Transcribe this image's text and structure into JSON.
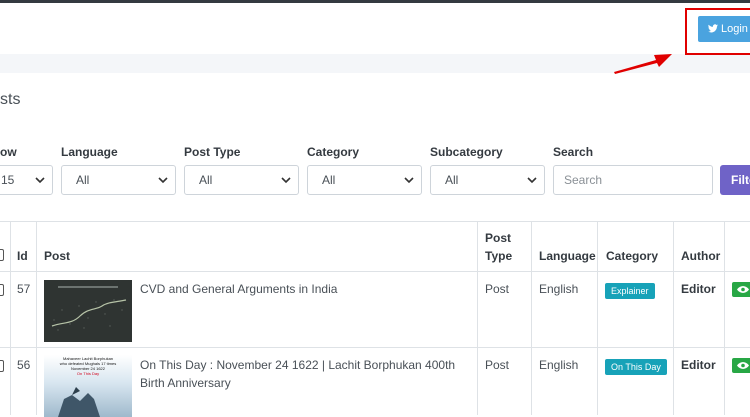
{
  "header": {
    "login_label": "Login w"
  },
  "card": {
    "title": "sts"
  },
  "filters": {
    "show": {
      "label": "ow",
      "value": "15"
    },
    "language": {
      "label": "Language",
      "value": "All"
    },
    "post_type": {
      "label": "Post Type",
      "value": "All"
    },
    "category": {
      "label": "Category",
      "value": "All"
    },
    "subcategory": {
      "label": "Subcategory",
      "value": "All"
    },
    "search": {
      "label": "Search",
      "placeholder": "Search"
    },
    "filter_button": "Filte"
  },
  "table": {
    "headers": {
      "id": "Id",
      "post": "Post",
      "post_type_1": "Post",
      "post_type_2": "Type",
      "language": "Language",
      "category": "Category",
      "author": "Author"
    },
    "rows": [
      {
        "id": "57",
        "post": "CVD and General Arguments in India",
        "post_type": "Post",
        "language": "English",
        "category": "Explainer",
        "author": "Editor"
      },
      {
        "id": "56",
        "post": "On This Day : November 24 1622 | Lachit Borphukan 400th Birth Anniversary",
        "post_type": "Post",
        "language": "English",
        "category": "On This Day",
        "author": "Editor"
      }
    ],
    "thumb2_text": {
      "line1": "Mahaveer Lachit Borphukan",
      "line2": "who defeated Mughals 17 times",
      "line3": "November 24 1622",
      "line4": "On This Day"
    }
  },
  "colors": {
    "login": "#4aa3df",
    "filter": "#6f63c7",
    "badge": "#17a2b8",
    "eye": "#28a745",
    "highlight": "#e00000"
  }
}
